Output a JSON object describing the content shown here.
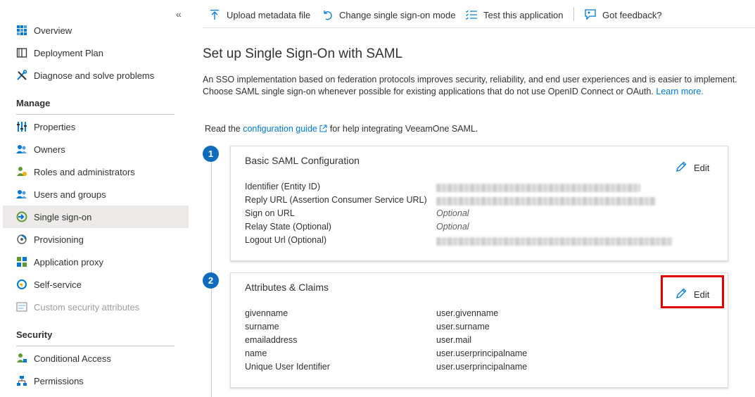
{
  "sidebar": {
    "collapse_glyph": "«",
    "items_top": [
      {
        "label": "Overview",
        "icon": "grid-icon"
      },
      {
        "label": "Deployment Plan",
        "icon": "book-icon"
      },
      {
        "label": "Diagnose and solve problems",
        "icon": "wrench-icon"
      }
    ],
    "manage_heading": "Manage",
    "items_manage": [
      {
        "label": "Properties",
        "icon": "properties-icon"
      },
      {
        "label": "Owners",
        "icon": "owners-icon"
      },
      {
        "label": "Roles and administrators",
        "icon": "roles-icon"
      },
      {
        "label": "Users and groups",
        "icon": "users-icon"
      },
      {
        "label": "Single sign-on",
        "icon": "sso-icon"
      },
      {
        "label": "Provisioning",
        "icon": "provisioning-icon"
      },
      {
        "label": "Application proxy",
        "icon": "app-proxy-icon"
      },
      {
        "label": "Self-service",
        "icon": "self-service-icon"
      },
      {
        "label": "Custom security attributes",
        "icon": "custom-attributes-icon"
      }
    ],
    "security_heading": "Security",
    "items_security": [
      {
        "label": "Conditional Access",
        "icon": "conditional-access-icon"
      },
      {
        "label": "Permissions",
        "icon": "permissions-icon"
      }
    ]
  },
  "toolbar": {
    "upload": "Upload metadata file",
    "change_mode": "Change single sign-on mode",
    "test": "Test this application",
    "feedback": "Got feedback?"
  },
  "main": {
    "title": "Set up Single Sign-On with SAML",
    "description": "An SSO implementation based on federation protocols improves security, reliability, and end user experiences and is easier to implement. Choose SAML single sign-on whenever possible for existing applications that do not use OpenID Connect or OAuth.",
    "learn_more": "Learn more.",
    "read_prefix": "Read the",
    "guide_link": "configuration guide",
    "read_suffix": "for help integrating VeeamOne SAML."
  },
  "steps": [
    {
      "number": "1",
      "title": "Basic SAML Configuration",
      "edit_label": "Edit",
      "rows": [
        {
          "key": "Identifier (Entity ID)",
          "value": ""
        },
        {
          "key": "Reply URL (Assertion Consumer Service URL)",
          "value": ""
        },
        {
          "key": "Sign on URL",
          "value": "Optional"
        },
        {
          "key": "Relay State (Optional)",
          "value": "Optional"
        },
        {
          "key": "Logout Url (Optional)",
          "value": ""
        }
      ]
    },
    {
      "number": "2",
      "title": "Attributes & Claims",
      "edit_label": "Edit",
      "rows": [
        {
          "key": "givenname",
          "value": "user.givenname"
        },
        {
          "key": "surname",
          "value": "user.surname"
        },
        {
          "key": "emailaddress",
          "value": "user.mail"
        },
        {
          "key": "name",
          "value": "user.userprincipalname"
        },
        {
          "key": "Unique User Identifier",
          "value": "user.userprincipalname"
        }
      ]
    }
  ],
  "colors": {
    "accent": "#0078d4",
    "step_badge": "#0f6cbd",
    "highlight": "#e00000"
  }
}
